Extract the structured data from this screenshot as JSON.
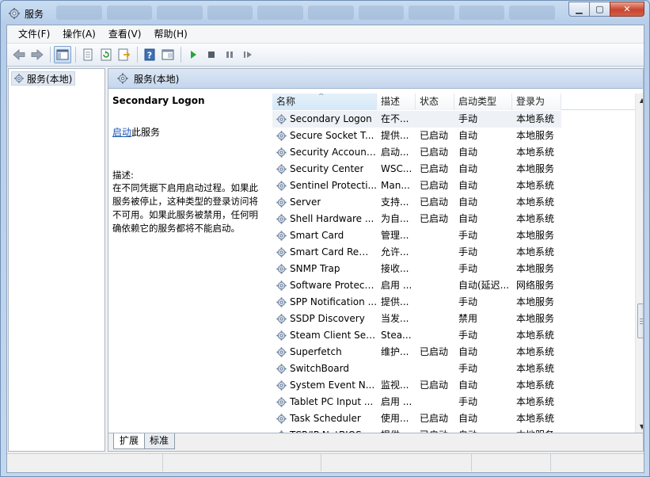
{
  "window": {
    "title": "服务",
    "controls": [
      "minimize",
      "maximize",
      "close"
    ]
  },
  "menubar": {
    "items": [
      "文件(F)",
      "操作(A)",
      "查看(V)",
      "帮助(H)"
    ]
  },
  "toolbar": {
    "icons": [
      "back-icon",
      "forward-icon",
      "show-hide-tree-icon",
      "properties-icon",
      "refresh-icon",
      "export-list-icon",
      "help-icon",
      "console-icon",
      "start-service-icon",
      "stop-service-icon",
      "pause-service-icon",
      "resume-service-icon"
    ]
  },
  "tree": {
    "item": "服务(本地)"
  },
  "main": {
    "header": "服务(本地)",
    "description": {
      "name": "Secondary Logon",
      "start_link": "启动",
      "start_suffix": "此服务",
      "label": "描述:",
      "text": "在不同凭据下启用启动过程。如果此服务被停止，这种类型的登录访问将不可用。如果此服务被禁用，任何明确依赖它的服务都将不能启动。"
    },
    "columns": [
      "名称",
      "描述",
      "状态",
      "启动类型",
      "登录为"
    ],
    "rows": [
      {
        "name": "Secondary Logon",
        "desc": "在不...",
        "status": "",
        "type": "手动",
        "logon": "本地系统"
      },
      {
        "name": "Secure Socket T...",
        "desc": "提供...",
        "status": "已启动",
        "type": "自动",
        "logon": "本地服务"
      },
      {
        "name": "Security Account...",
        "desc": "启动...",
        "status": "已启动",
        "type": "自动",
        "logon": "本地系统"
      },
      {
        "name": "Security Center",
        "desc": "WSC...",
        "status": "已启动",
        "type": "自动",
        "logon": "本地服务"
      },
      {
        "name": "Sentinel Protecti...",
        "desc": "Man...",
        "status": "已启动",
        "type": "自动",
        "logon": "本地系统"
      },
      {
        "name": "Server",
        "desc": "支持...",
        "status": "已启动",
        "type": "自动",
        "logon": "本地系统"
      },
      {
        "name": "Shell Hardware ...",
        "desc": "为自...",
        "status": "已启动",
        "type": "自动",
        "logon": "本地系统"
      },
      {
        "name": "Smart Card",
        "desc": "管理...",
        "status": "",
        "type": "手动",
        "logon": "本地服务"
      },
      {
        "name": "Smart Card Rem...",
        "desc": "允许...",
        "status": "",
        "type": "手动",
        "logon": "本地系统"
      },
      {
        "name": "SNMP Trap",
        "desc": "接收...",
        "status": "",
        "type": "手动",
        "logon": "本地服务"
      },
      {
        "name": "Software Protect...",
        "desc": "启用 ...",
        "status": "",
        "type": "自动(延迟...",
        "logon": "网络服务"
      },
      {
        "name": "SPP Notification ...",
        "desc": "提供...",
        "status": "",
        "type": "手动",
        "logon": "本地服务"
      },
      {
        "name": "SSDP Discovery",
        "desc": "当发...",
        "status": "",
        "type": "禁用",
        "logon": "本地服务"
      },
      {
        "name": "Steam Client Ser...",
        "desc": "Stea...",
        "status": "",
        "type": "手动",
        "logon": "本地系统"
      },
      {
        "name": "Superfetch",
        "desc": "维护...",
        "status": "已启动",
        "type": "自动",
        "logon": "本地系统"
      },
      {
        "name": "SwitchBoard",
        "desc": "",
        "status": "",
        "type": "手动",
        "logon": "本地系统"
      },
      {
        "name": "System Event N...",
        "desc": "监视...",
        "status": "已启动",
        "type": "自动",
        "logon": "本地系统"
      },
      {
        "name": "Tablet PC Input ...",
        "desc": "启用 ...",
        "status": "",
        "type": "手动",
        "logon": "本地系统"
      },
      {
        "name": "Task Scheduler",
        "desc": "使用...",
        "status": "已启动",
        "type": "自动",
        "logon": "本地系统"
      },
      {
        "name": "TCP/IP NetBIOS ...",
        "desc": "提供...",
        "status": "已启动",
        "type": "自动",
        "logon": "本地服务"
      }
    ],
    "tabs": [
      "扩展",
      "标准"
    ]
  }
}
